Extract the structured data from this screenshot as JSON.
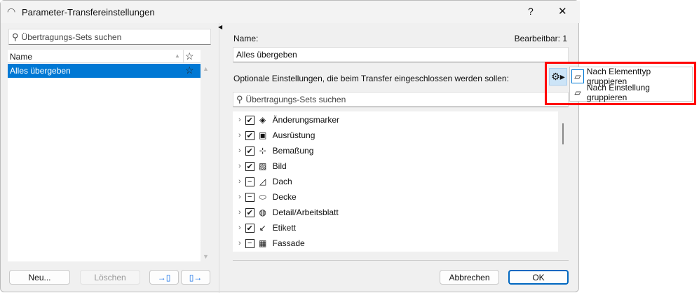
{
  "window": {
    "title": "Parameter-Transfereinstellungen",
    "help": "?",
    "close": "✕"
  },
  "left": {
    "search_placeholder": "Übertragungs-Sets suchen",
    "column_name": "Name",
    "items": [
      {
        "label": "Alles übergeben",
        "selected": true
      }
    ],
    "buttons": {
      "new": "Neu...",
      "delete": "Löschen"
    }
  },
  "right": {
    "name_label": "Name:",
    "editable": "Bearbeitbar: 1",
    "name_value": "Alles übergeben",
    "optional_label": "Optionale Einstellungen, die beim Transfer eingeschlossen werden sollen:",
    "search_placeholder": "Übertragungs-Sets suchen",
    "tree": [
      {
        "label": "Änderungsmarker",
        "state": "checked",
        "icon": "◈"
      },
      {
        "label": "Ausrüstung",
        "state": "checked",
        "icon": "▣"
      },
      {
        "label": "Bemaßung",
        "state": "checked",
        "icon": "⊹"
      },
      {
        "label": "Bild",
        "state": "checked",
        "icon": "▨"
      },
      {
        "label": "Dach",
        "state": "partial",
        "icon": "◿"
      },
      {
        "label": "Decke",
        "state": "partial",
        "icon": "⬭"
      },
      {
        "label": "Detail/Arbeitsblatt",
        "state": "checked",
        "icon": "◍"
      },
      {
        "label": "Etikett",
        "state": "checked",
        "icon": "↙"
      },
      {
        "label": "Fassade",
        "state": "partial",
        "icon": "▦"
      }
    ],
    "cancel": "Abbrechen",
    "ok": "OK"
  },
  "menu": {
    "items": [
      "Nach Elementtyp gruppieren",
      "Nach Einstellung gruppieren"
    ],
    "highlight_color": "#ff0000"
  }
}
